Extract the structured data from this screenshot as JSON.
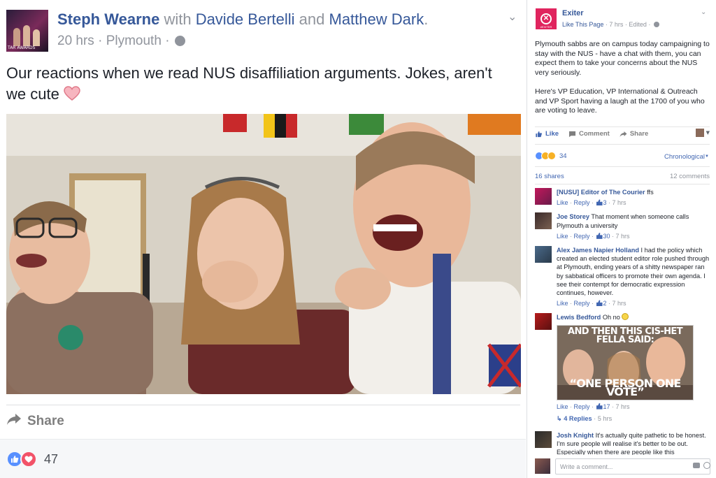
{
  "post": {
    "author": "Steph Wearne",
    "with_word": "with",
    "tagged_1": "Davide Bertelli",
    "and_word": "and",
    "tagged_2": "Matthew Dark",
    "period": ".",
    "avatar_caption": "TAR AWARDS",
    "time": "20 hrs",
    "location": "Plymouth",
    "dot": "·",
    "text": "Our reactions when we read NUS disaffiliation arguments. Jokes, aren't we cute",
    "share_label": "Share",
    "reaction_count": "47"
  },
  "side": {
    "page_name": "Exiter",
    "avatar_tag": "#EXITER",
    "like_page": "Like This Page",
    "timestamp": "7 hrs",
    "edited": "Edited",
    "paragraph_1": "Plymouth sabbs are on campus today campaigning to stay with the NUS - have a chat with them, you can expect them to take your concerns about the NUS very seriously.",
    "paragraph_2": "Here's VP Education, VP International & Outreach and VP Sport having a laugh at the 1700 of you who are voting to leave.",
    "actions": {
      "like": "Like",
      "comment": "Comment",
      "share": "Share"
    },
    "reaction_count": "34",
    "sort_label": "Chronological",
    "shares": "16 shares",
    "comments_count": "12 comments",
    "comments": [
      {
        "name": "[NUSU] Editor of The Courier",
        "text": "ffs",
        "like": "Like",
        "reply": "Reply",
        "likes": "3",
        "time": "7 hrs"
      },
      {
        "name": "Joe Storey",
        "text": "That moment when someone calls Plymouth a university",
        "like": "Like",
        "reply": "Reply",
        "likes": "30",
        "time": "7 hrs"
      },
      {
        "name": "Alex James Napier Holland",
        "text": "I had the policy which created an elected student editor role pushed through at Plymouth, ending years of a shitty newspaper ran by sabbatical officers to promote their own agenda. I see their contempt for democratic expression continues, however.",
        "like": "Like",
        "reply": "Reply",
        "likes": "2",
        "time": "7 hrs"
      },
      {
        "name": "Lewis Bedford",
        "text": "Oh no",
        "meme_top": "AND THEN THIS CIS-HET FELLA SAID:",
        "meme_bottom": "“ONE PERSON ONE VOTE”",
        "like": "Like",
        "reply": "Reply",
        "likes": "17",
        "time": "7 hrs",
        "replies": "4 Replies",
        "replies_time": "5 hrs"
      },
      {
        "name": "Josh Knight",
        "text": "It's actually quite pathetic to be honest. I'm sure people will realise it's better to be out. Especially when there are people like this"
      }
    ],
    "write_placeholder": "Write a comment..."
  },
  "colors": {
    "link": "#365899",
    "muted": "#90949c",
    "like_blue": "#5890ff",
    "love_red": "#f25268",
    "brand_pink": "#e0245e"
  }
}
